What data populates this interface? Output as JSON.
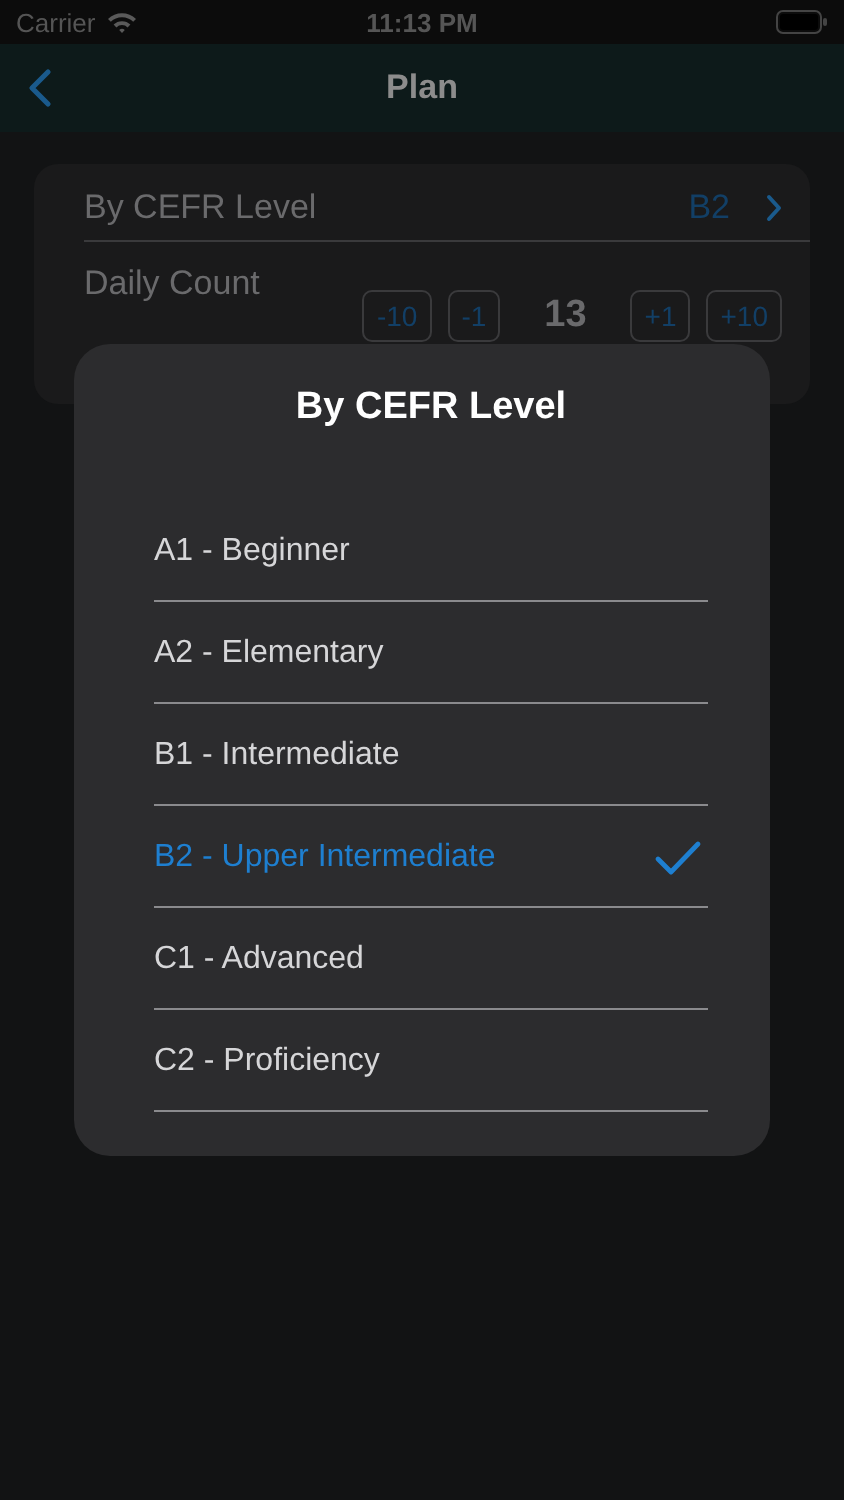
{
  "status_bar": {
    "carrier": "Carrier",
    "time": "11:13 PM"
  },
  "nav": {
    "title": "Plan"
  },
  "settings": {
    "level_label": "By CEFR Level",
    "level_value": "B2",
    "count_label": "Daily Count",
    "count": "13",
    "steppers": [
      {
        "label": "-10"
      },
      {
        "label": "-1"
      },
      {
        "label": "+1"
      },
      {
        "label": "+10"
      }
    ]
  },
  "dialog": {
    "title": "By CEFR Level",
    "options": [
      {
        "label": "A1 - Beginner",
        "selected": false
      },
      {
        "label": "A2 - Elementary",
        "selected": false
      },
      {
        "label": "B1 - Intermediate",
        "selected": false
      },
      {
        "label": "B2 - Upper Intermediate",
        "selected": true
      },
      {
        "label": "C1 - Advanced",
        "selected": false
      },
      {
        "label": "C2 - Proficiency",
        "selected": false
      }
    ]
  }
}
